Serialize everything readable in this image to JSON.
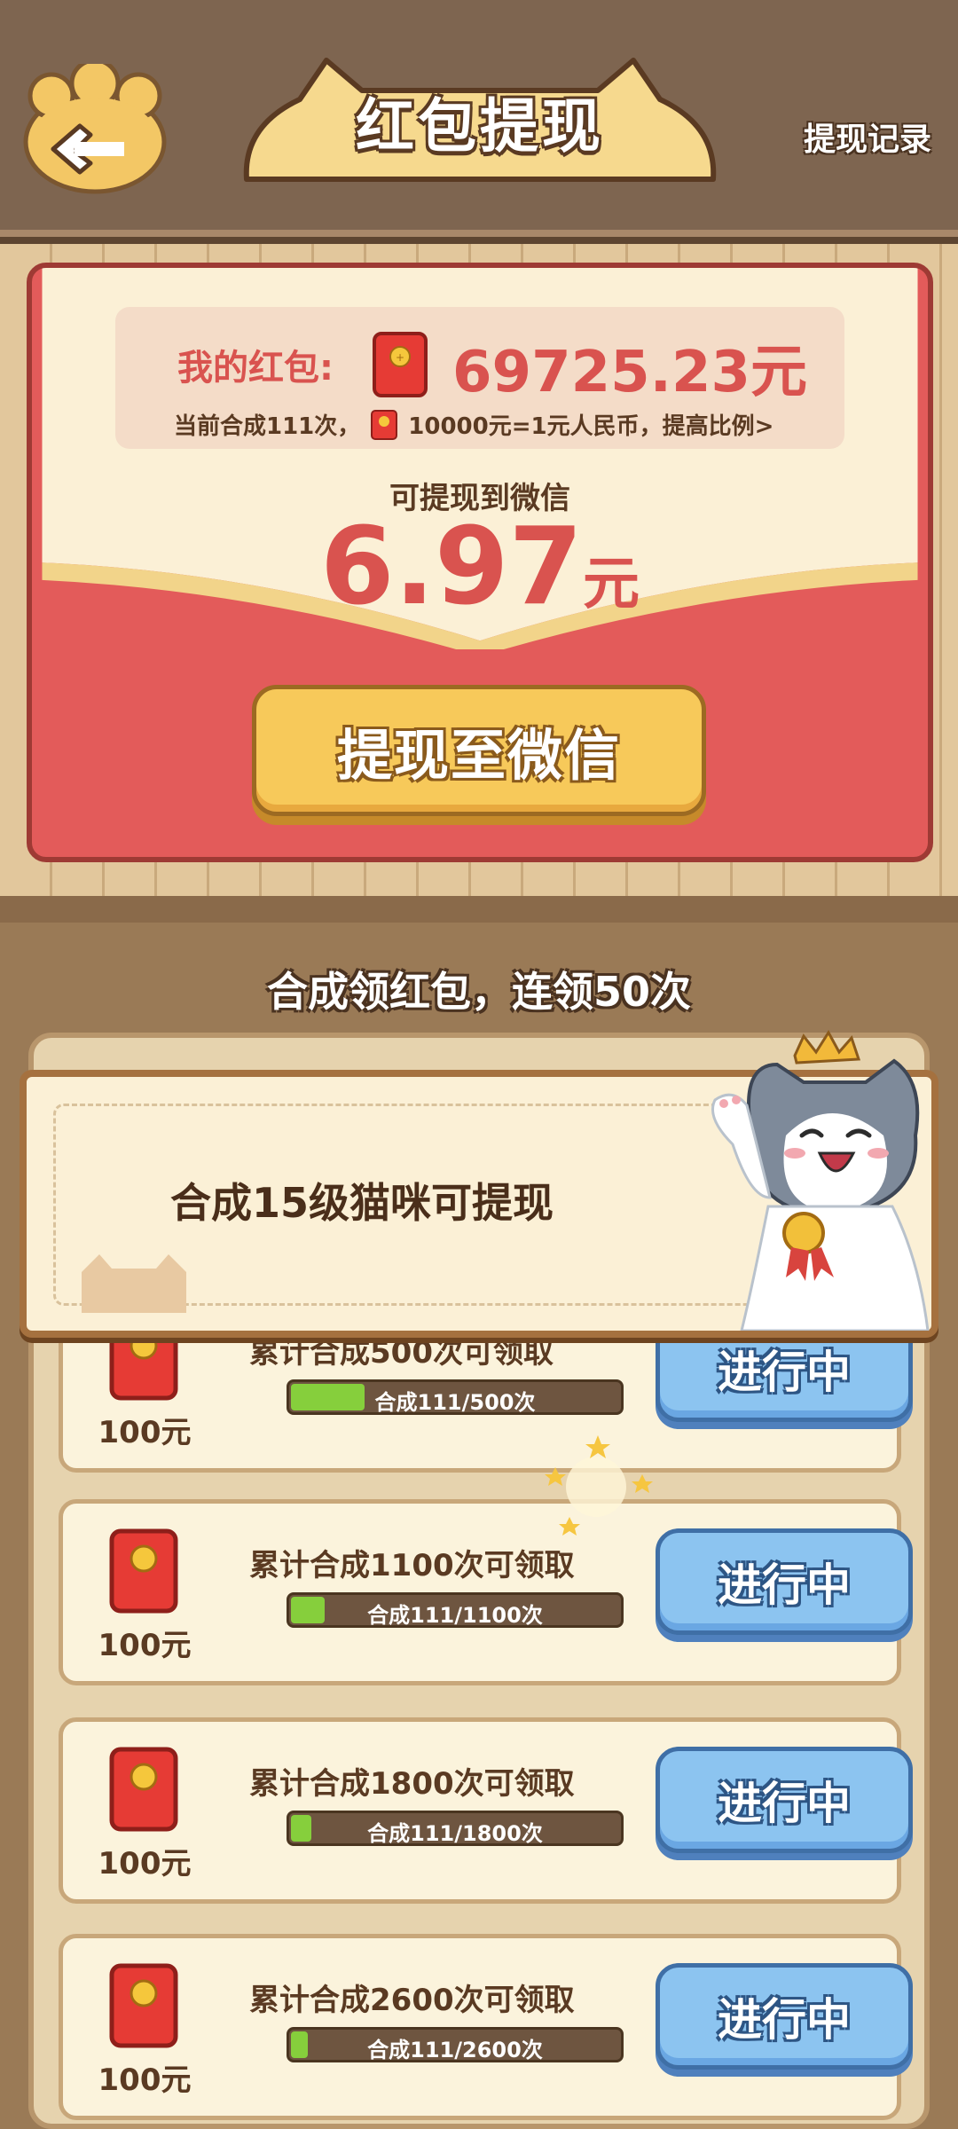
{
  "header": {
    "title": "红包提现",
    "record_link": "提现记录",
    "back_icon": "back-arrow-icon"
  },
  "wallet": {
    "label": "我的红包:",
    "amount": "69725.23元",
    "rate_prefix": "当前合成111次，",
    "rate_text": "10000元=1元人民币，提高比例>",
    "withdraw_label": "可提现到微信",
    "withdraw_value": "6.97",
    "withdraw_unit": "元",
    "withdraw_button": "提现至微信"
  },
  "tasks": {
    "title": "合成领红包，连领50次",
    "banner_text": "合成15级猫咪可提现",
    "items": [
      {
        "reward": "100元",
        "desc": "累计合成500次可领取",
        "progress_text": "合成111/500次",
        "progress": 0.222,
        "status": "进行中"
      },
      {
        "reward": "100元",
        "desc": "累计合成1100次可领取",
        "progress_text": "合成111/1100次",
        "progress": 0.1009,
        "status": "进行中"
      },
      {
        "reward": "100元",
        "desc": "累计合成1800次可领取",
        "progress_text": "合成111/1800次",
        "progress": 0.0617,
        "status": "进行中"
      },
      {
        "reward": "100元",
        "desc": "累计合成2600次可领取",
        "progress_text": "合成111/2600次",
        "progress": 0.0427,
        "status": "进行中"
      }
    ]
  },
  "colors": {
    "accent_red": "#d9534f",
    "button_gold": "#f7c95a",
    "button_blue": "#8cc4f0",
    "progress_green": "#86cf3c"
  }
}
